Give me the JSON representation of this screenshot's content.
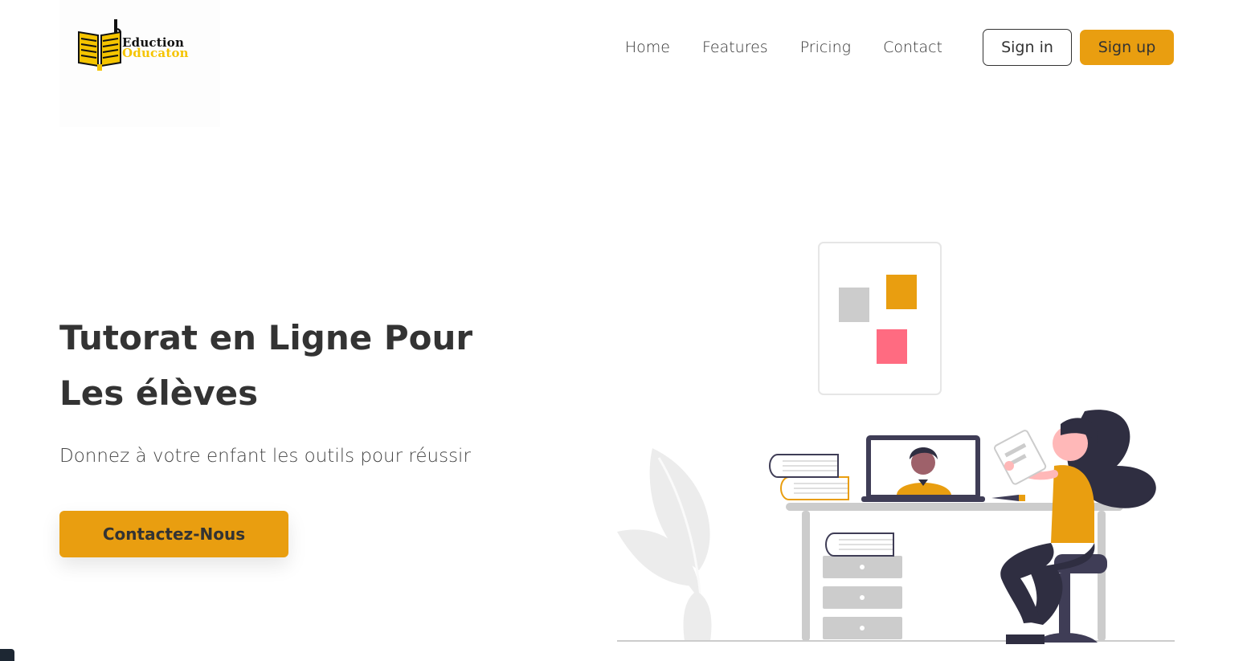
{
  "brand": {
    "word1": "Eduction",
    "word2": "Oducaton",
    "colors": {
      "accent": "#e99e10",
      "logo_yellow": "#f5c400",
      "pink": "#ff6b81",
      "dark": "#2f2e41"
    },
    "logo_icon": "open-book-icon"
  },
  "nav": {
    "links": [
      "Home",
      "Features",
      "Pricing",
      "Contact"
    ],
    "sign_in": "Sign in",
    "sign_up": "Sign up"
  },
  "hero": {
    "title_line1": "Tutorat en Ligne Pour",
    "title_line2": "Les élèves",
    "subtitle": "Donnez à votre enfant les outils pour réussir",
    "cta": "Contactez-Nous"
  },
  "illustration": {
    "name": "online-tutoring-illustration"
  }
}
